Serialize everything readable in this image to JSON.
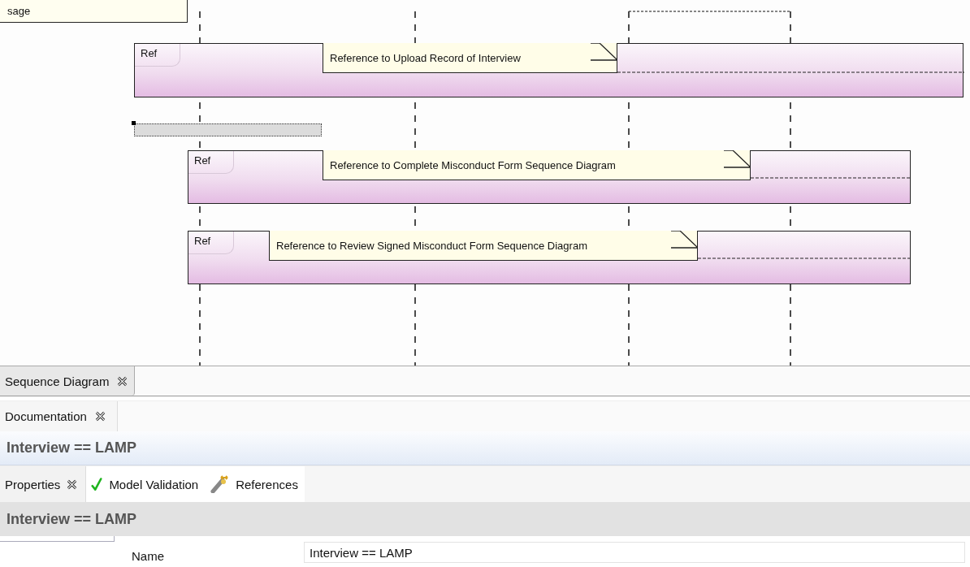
{
  "diagram": {
    "top_note": "sage",
    "references": [
      {
        "label": "Ref",
        "note": "Reference to Upload Record of Interview"
      },
      {
        "label": "Ref",
        "note": "Reference to Complete Misconduct Form Sequence Diagram"
      },
      {
        "label": "Ref",
        "note": "Reference to Review Signed Misconduct Form Sequence Diagram"
      }
    ]
  },
  "editor_tab": {
    "label": "Sequence Diagram"
  },
  "documentation": {
    "tab": "Documentation",
    "heading": "Interview == LAMP"
  },
  "properties": {
    "tabs": [
      {
        "label": "Properties",
        "selected": true
      },
      {
        "label": "Model Validation",
        "selected": false
      },
      {
        "label": "References",
        "selected": false
      }
    ],
    "heading": "Interview == LAMP",
    "fields": [
      {
        "label": "Name",
        "value": "Interview == LAMP"
      }
    ]
  }
}
